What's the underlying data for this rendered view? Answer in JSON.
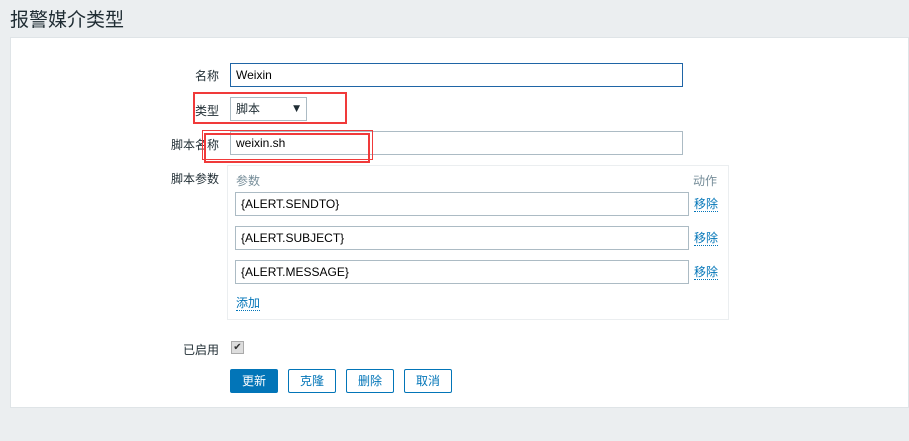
{
  "page_title": "报警媒介类型",
  "form": {
    "name_label": "名称",
    "name_value": "Weixin",
    "type_label": "类型",
    "type_value": "脚本",
    "script_name_label": "脚本名称",
    "script_name_value": "weixin.sh",
    "script_params_label": "脚本参数",
    "params_header": "参数",
    "action_header": "动作",
    "params": [
      {
        "value": "{ALERT.SENDTO}",
        "remove": "移除"
      },
      {
        "value": "{ALERT.SUBJECT}",
        "remove": "移除"
      },
      {
        "value": "{ALERT.MESSAGE}",
        "remove": "移除"
      }
    ],
    "add_label": "添加",
    "enabled_label": "已启用",
    "enabled": true
  },
  "buttons": {
    "update": "更新",
    "clone": "克隆",
    "delete": "删除",
    "cancel": "取消"
  },
  "colors": {
    "accent": "#0275b8",
    "highlight": "#f03a3a"
  }
}
